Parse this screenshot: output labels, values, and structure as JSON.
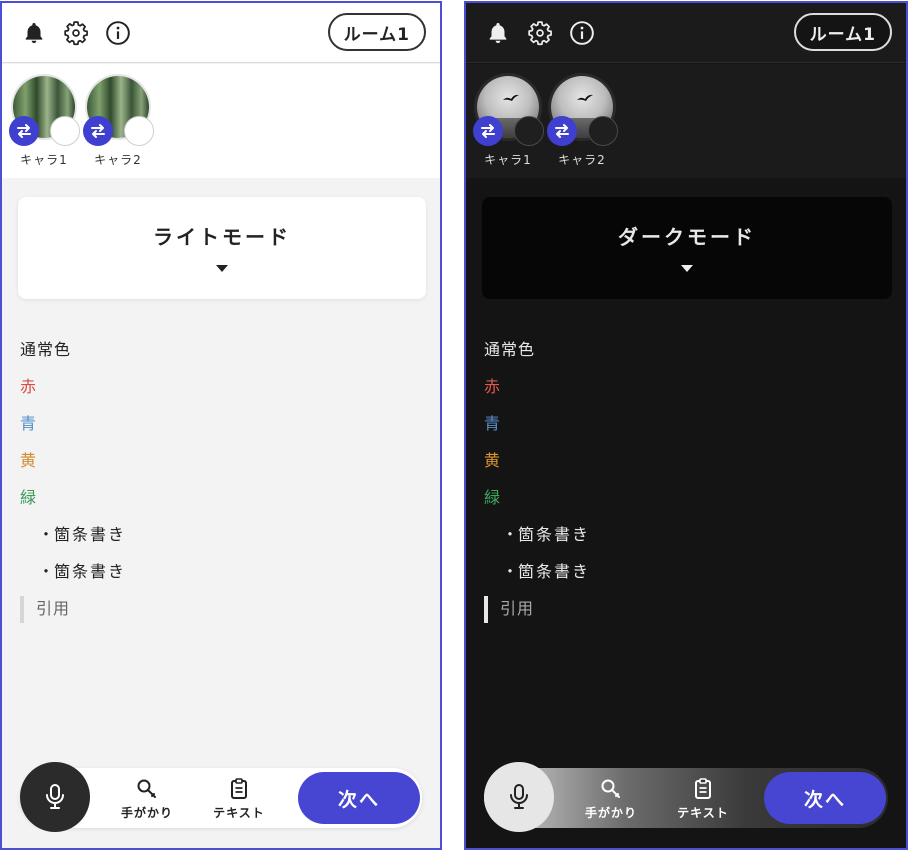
{
  "panels": [
    {
      "mode_name": "ライトモード",
      "room_label": "ルーム1",
      "characters": [
        {
          "name": "キャラ1"
        },
        {
          "name": "キャラ2"
        }
      ],
      "content": {
        "normal": "通常色",
        "red": "赤",
        "blue": "青",
        "yellow": "黄",
        "green": "緑",
        "bullets": [
          "箇条書き",
          "箇条書き"
        ],
        "quote": "引用"
      },
      "colors": {
        "red": "#d84a44",
        "blue": "#4f8ec8",
        "yellow": "#d48a2e",
        "green": "#3a9a5a"
      },
      "bottom": {
        "hint_label": "手がかり",
        "text_label": "テキスト",
        "next_label": "次へ"
      }
    },
    {
      "mode_name": "ダークモード",
      "room_label": "ルーム1",
      "characters": [
        {
          "name": "キャラ1"
        },
        {
          "name": "キャラ2"
        }
      ],
      "content": {
        "normal": "通常色",
        "red": "赤",
        "blue": "青",
        "yellow": "黄",
        "green": "緑",
        "bullets": [
          "箇条書き",
          "箇条書き"
        ],
        "quote": "引用"
      },
      "colors": {
        "red": "#e25a52",
        "blue": "#5a8fd0",
        "yellow": "#d8962e",
        "green": "#3da85e"
      },
      "bottom": {
        "hint_label": "手がかり",
        "text_label": "テキスト",
        "next_label": "次へ"
      }
    }
  ],
  "icons": {
    "bell": "bell-icon",
    "settings": "gear-icon",
    "info": "info-icon",
    "swap": "swap-icon",
    "mic": "microphone-icon",
    "hint": "magnifier-key-icon",
    "text": "clipboard-icon",
    "caret": "caret-down-icon"
  },
  "accent_color": "#4646d2"
}
